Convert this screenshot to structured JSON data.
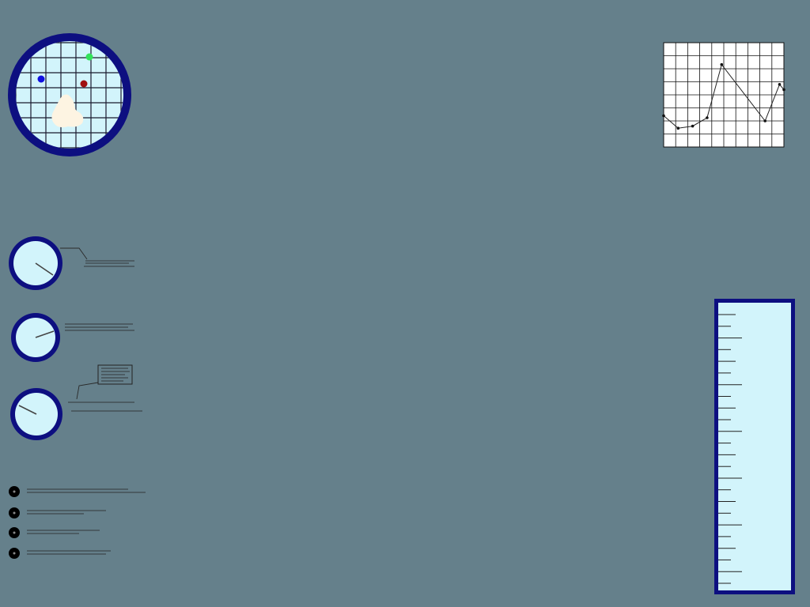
{
  "colors": {
    "background": "#65808b",
    "bezel": "#0d0f80",
    "face": "#d2f4fb",
    "grid": "#1a1a2e",
    "needle": "#444444",
    "plot_line": "#222222",
    "marker_green": "#32e35a",
    "marker_blue": "#1010e0",
    "marker_red": "#a01010",
    "blob": "#fdf4e2",
    "bullet": "#000000"
  },
  "radar": {
    "icon": "radar-scope-icon",
    "markers": [
      {
        "name": "green-marker",
        "color": "#32e35a"
      },
      {
        "name": "blue-marker",
        "color": "#1010e0"
      },
      {
        "name": "red-marker",
        "color": "#a01010"
      }
    ]
  },
  "gauges": [
    {
      "name": "gauge-1",
      "needle_angle_deg": 152
    },
    {
      "name": "gauge-2",
      "needle_angle_deg": 20
    },
    {
      "name": "gauge-3",
      "needle_angle_deg": 150
    }
  ],
  "list": {
    "bullet_icon": "bullet-dot-icon",
    "count_items": 4
  },
  "chart_data": {
    "type": "line",
    "title": "",
    "xlabel": "",
    "ylabel": "",
    "grid": true,
    "x": [
      0,
      1,
      2,
      3,
      4,
      7,
      8,
      8.3
    ],
    "y": [
      3.0,
      1.8,
      2.0,
      2.8,
      7.9,
      2.5,
      6.0,
      5.5
    ],
    "xlim": [
      0,
      8.3
    ],
    "ylim": [
      0,
      10
    ]
  },
  "thermometer": {
    "icon": "ruler-gauge-icon",
    "tick_count": 24
  }
}
